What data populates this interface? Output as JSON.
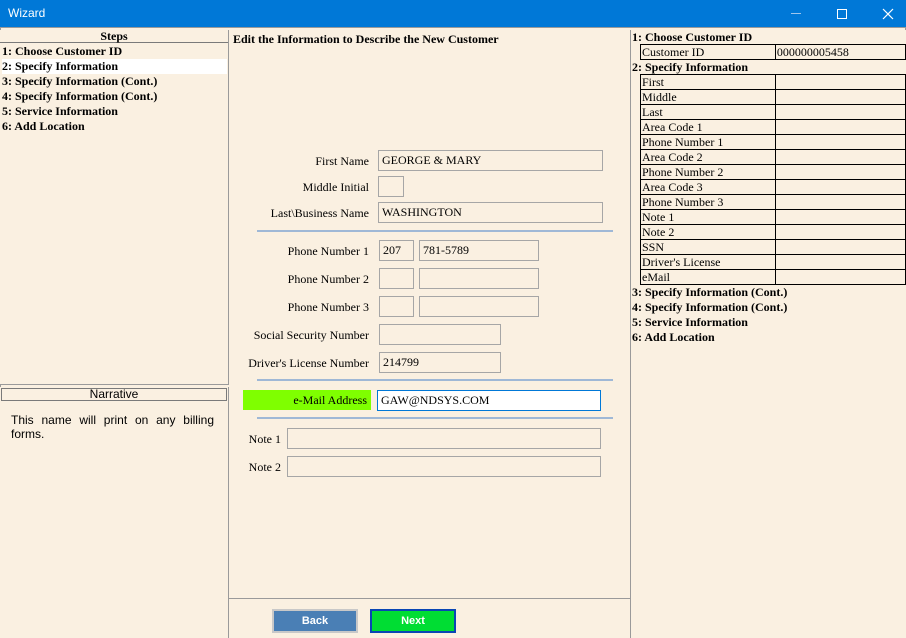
{
  "window": {
    "title": "Wizard"
  },
  "steps": {
    "header": "Steps",
    "items": [
      "1: Choose Customer ID",
      "2: Specify Information",
      "3: Specify Information (Cont.)",
      "4: Specify Information (Cont.)",
      "5: Service Information",
      "6: Add Location"
    ],
    "selected_index": 1
  },
  "narrative": {
    "header": "Narrative",
    "text": "This name will print on any billing forms."
  },
  "form": {
    "title": "Edit the Information to Describe the New Customer",
    "first_name": {
      "label": "First Name",
      "value": "GEORGE & MARY"
    },
    "middle_initial": {
      "label": "Middle Initial",
      "value": ""
    },
    "last_name": {
      "label": "Last\\Business Name",
      "value": "WASHINGTON"
    },
    "phone1": {
      "label": "Phone Number 1",
      "area": "207",
      "number": "781-5789"
    },
    "phone2": {
      "label": "Phone Number 2",
      "area": "",
      "number": ""
    },
    "phone3": {
      "label": "Phone Number 3",
      "area": "",
      "number": ""
    },
    "ssn": {
      "label": "Social Security Number",
      "value": ""
    },
    "drivers_license": {
      "label": "Driver's License Number",
      "value": "214799"
    },
    "email": {
      "label": "e-Mail Address",
      "value": "GAW@NDSYS.COM"
    },
    "note1": {
      "label": "Note 1",
      "value": ""
    },
    "note2": {
      "label": "Note 2",
      "value": ""
    }
  },
  "buttons": {
    "back": "Back",
    "next": "Next"
  },
  "summary": {
    "section1": "1: Choose Customer ID",
    "customer_id_label": "Customer  ID",
    "customer_id_value": "000000005458",
    "section2": "2: Specify Information",
    "rows": [
      "First",
      "Middle",
      "Last",
      "Area Code 1",
      "Phone Number 1",
      "Area Code 2",
      "Phone Number 2",
      "Area Code 3",
      "Phone Number 3",
      "Note 1",
      "Note 2",
      "SSN",
      "Driver's License",
      "eMail"
    ],
    "section3": "3: Specify Information (Cont.)",
    "section4": "4: Specify Information (Cont.)",
    "section5": "5: Service Information",
    "section6": "6: Add Location"
  },
  "colors": {
    "titlebar": "#0078d7",
    "panel": "#faf0e1",
    "email_highlight": "#7fff00",
    "next_button": "#00dd33",
    "back_button": "#4a7fb5"
  }
}
